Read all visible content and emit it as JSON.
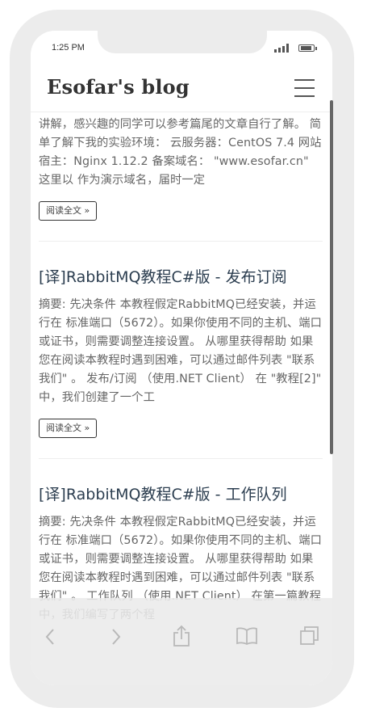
{
  "status": {
    "time": "1:25 PM"
  },
  "header": {
    "title": "Esofar's blog",
    "menu_icon": "hamburger-menu-icon"
  },
  "posts": [
    {
      "summary": "讲解，感兴趣的同学可以参考篇尾的文章自行了解。 简单了解下我的实验环境： 云服务器：CentOS 7.4 网站宿主：Nginx 1.12.2 备案域名： \"www.esofar.cn\" 这里以 作为演示域名，届时一定",
      "read_more": "阅读全文 »"
    },
    {
      "title": "[译]RabbitMQ教程C#版 - 发布订阅",
      "summary": "摘要: 先决条件 本教程假定RabbitMQ已经安装，并运行在 标准端口（5672）。如果你使用不同的主机、端口或证书，则需要调整连接设置。 从哪里获得帮助 如果您在阅读本教程时遇到困难，可以通过邮件列表 \"联系我们\" 。 发布/订阅 （使用.NET Client） 在 \"教程[2]\" 中，我们创建了一个工",
      "read_more": "阅读全文 »"
    },
    {
      "title": "[译]RabbitMQ教程C#版 - 工作队列",
      "summary": "摘要: 先决条件 本教程假定RabbitMQ已经安装，并运行在 标准端口（5672）。如果你使用不同的主机、端口或证书，则需要调整连接设置。 从哪里获得帮助 如果您在阅读本教程时遇到困难，可以通过邮件列表 \"联系我们\" 。 工作队列 （使用.NET Client） 在第一篇教程中，我们编写了两个程"
    }
  ],
  "toolbar": {
    "back_icon": "back-chevron-icon",
    "forward_icon": "forward-chevron-icon",
    "share_icon": "share-icon",
    "bookmarks_icon": "book-icon",
    "tabs_icon": "tabs-icon"
  }
}
